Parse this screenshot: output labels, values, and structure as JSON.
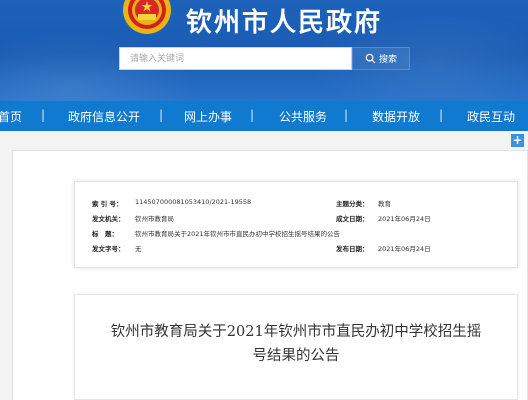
{
  "header": {
    "site_title": "钦州市人民政府",
    "search_placeholder": "请输入关键词",
    "search_button": "搜索",
    "brand_color": "#1d61b9"
  },
  "nav": {
    "items": [
      "首页",
      "政府信息公开",
      "网上办事",
      "公共服务",
      "数据开放",
      "政民互动"
    ],
    "separator": "|",
    "bar_color": "#0f7ad0"
  },
  "toolbar": {
    "plus_icon": "plus-icon",
    "plus_label": "+"
  },
  "meta": {
    "index_label": "索 引 号：",
    "index_value": "11450700008105341​0/2021-19558",
    "topic_label": "主题分类：",
    "topic_value": "教育",
    "issuer_label": "发文机关：",
    "issuer_value": "钦州市教育局",
    "created_label": "成文日期：",
    "created_value": "2021年06月24日",
    "title_label": "标　题：",
    "title_value": "钦州市教育局关于2021年钦州市市直民办初中学校招生摇号结果的公告",
    "doc_no_label": "发文字号：",
    "doc_no_value": "无",
    "published_label": "发布日期：",
    "published_value": "2021年06月24日"
  },
  "article": {
    "title_line1": "钦州市教育局关于2021年钦州市市直民办初中学校招生摇",
    "title_line2": "号结果的公告"
  }
}
